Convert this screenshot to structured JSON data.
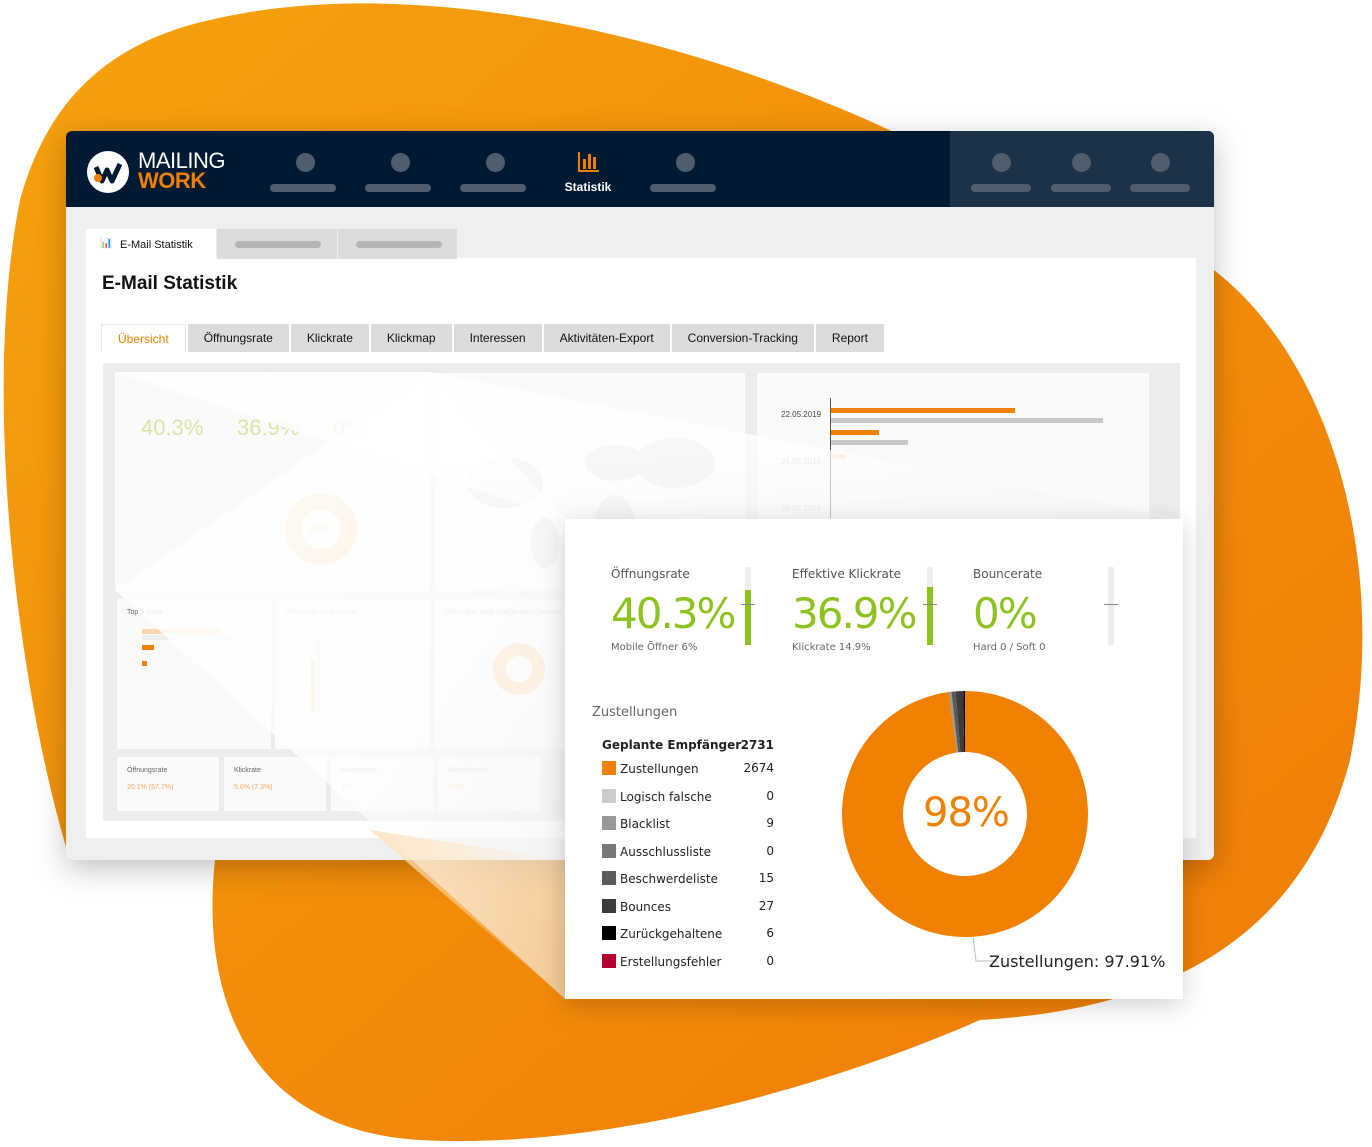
{
  "colors": {
    "brand_orange": "#f08000",
    "navy": "#011a33",
    "green": "#8dc21f"
  },
  "logo": {
    "line1": "MAILING",
    "line2": "WORK"
  },
  "nav": {
    "active_label": "Statistik",
    "active_icon": "bar-chart-icon"
  },
  "page_tab": {
    "label": "E-Mail Statistik",
    "icon": "bar-chart-icon"
  },
  "page_title": "E-Mail Statistik",
  "tabs": [
    "Übersicht",
    "Öffnungsrate",
    "Klickrate",
    "Klickmap",
    "Interessen",
    "Aktivitäten-Export",
    "Conversion-Tracking",
    "Report"
  ],
  "active_tab": "Übersicht",
  "background_dashboard": {
    "kpis": [
      "40.3%",
      "36.9%",
      "0%"
    ],
    "donut_label": "98%",
    "dates": [
      "22.05.2019",
      "24.05.2019",
      "26.05.2019"
    ],
    "top_links_title": "Top 5 Links",
    "opens_by_date_title": "Öffnungen nach Datum",
    "devices_title": "Öffnungen nach Endgeräten (gesamt)",
    "small_cards": [
      {
        "label": "Öffnungsrate",
        "value": "20.1% (57.7%)"
      },
      {
        "label": "Klickrate",
        "value": "5.6% (7.3%)"
      },
      {
        "label": "Bouncerate",
        "value": "1%"
      },
      {
        "label": "Abmelderate",
        "value": "0.3%"
      }
    ]
  },
  "card": {
    "kpis": [
      {
        "label": "Öffnungsrate",
        "value": "40.3%",
        "sub": "Mobile Öffner 6%",
        "gauge": 0.85
      },
      {
        "label": "Effektive Klickrate",
        "value": "36.9%",
        "sub": "Klickrate 14.9%",
        "gauge": 0.88
      },
      {
        "label": "Bouncerate",
        "value": "0%",
        "sub": "Hard 0 / Soft 0",
        "gauge": 0
      }
    ],
    "section_title": "Zustellungen",
    "planned": {
      "label": "Geplante Empfänger",
      "value": "2731"
    },
    "legend": [
      {
        "label": "Zustellungen",
        "value": "2674",
        "color": "#f08000"
      },
      {
        "label": "Logisch falsche",
        "value": "0",
        "color": "#cccccc"
      },
      {
        "label": "Blacklist",
        "value": "9",
        "color": "#999999"
      },
      {
        "label": "Ausschlussliste",
        "value": "0",
        "color": "#777777"
      },
      {
        "label": "Beschwerdeliste",
        "value": "15",
        "color": "#5a5a5a"
      },
      {
        "label": "Bounces",
        "value": "27",
        "color": "#3c3c3c"
      },
      {
        "label": "Zurückgehaltene",
        "value": "6",
        "color": "#000000"
      },
      {
        "label": "Erstellungsfehler",
        "value": "0",
        "color": "#b5002f"
      }
    ],
    "donut_center": "98%",
    "donut_callout": "Zustellungen: 97.91%"
  }
}
